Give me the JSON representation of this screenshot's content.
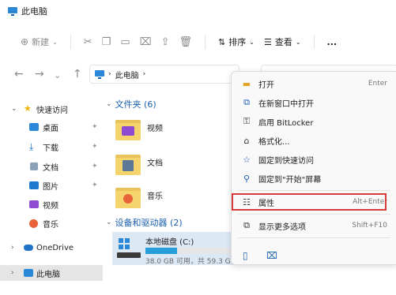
{
  "window": {
    "title": "此电脑"
  },
  "toolbar": {
    "new_label": "新建",
    "sort_label": "排序",
    "view_label": "查看",
    "more_label": "..."
  },
  "address": {
    "crumb": "此电脑"
  },
  "sidebar": {
    "quick_access": "快速访问",
    "items": [
      {
        "label": "桌面"
      },
      {
        "label": "下载"
      },
      {
        "label": "文档"
      },
      {
        "label": "图片"
      },
      {
        "label": "视频"
      },
      {
        "label": "音乐"
      }
    ],
    "onedrive": "OneDrive",
    "this_pc": "此电脑"
  },
  "content": {
    "folders_header": "文件夹 (6)",
    "folders": [
      {
        "name": "视频"
      },
      {
        "name": "文档"
      },
      {
        "name": "音乐"
      }
    ],
    "drives_header": "设备和驱动器 (2)",
    "drive": {
      "name": "本地磁盘 (C:)",
      "info": "38.0 GB 可用，共 59.3 G",
      "used_fraction": 0.36
    }
  },
  "context_menu": {
    "items": [
      {
        "label": "打开",
        "shortcut": "Enter"
      },
      {
        "label": "在新窗口中打开",
        "shortcut": ""
      },
      {
        "label": "启用 BitLocker",
        "shortcut": ""
      },
      {
        "label": "格式化...",
        "shortcut": ""
      },
      {
        "label": "固定到快速访问",
        "shortcut": ""
      },
      {
        "label": "固定到\"开始\"屏幕",
        "shortcut": ""
      },
      {
        "label": "属性",
        "shortcut": "Alt+Enter"
      },
      {
        "label": "显示更多选项",
        "shortcut": "Shift+F10"
      }
    ]
  },
  "colors": {
    "accent": "#1b5fae",
    "highlight": "#d83b3b",
    "drive_fill": "#26a0da"
  }
}
